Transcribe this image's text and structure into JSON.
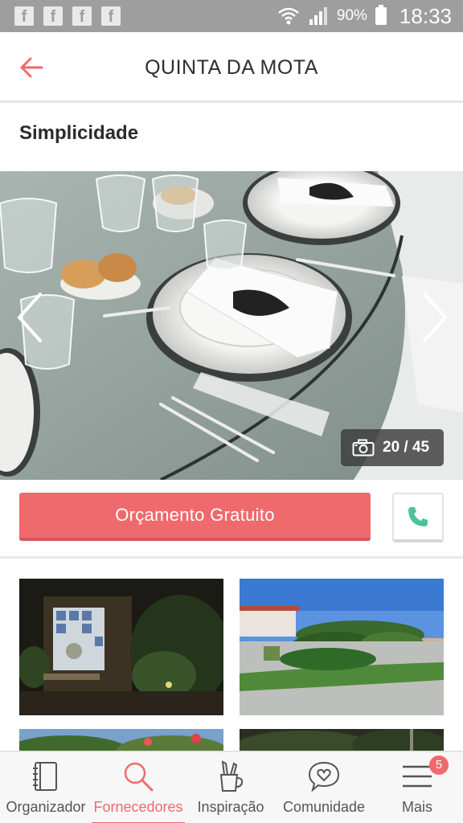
{
  "status_bar": {
    "notification_icons": [
      "facebook-icon",
      "facebook-icon",
      "facebook-icon",
      "facebook-icon"
    ],
    "battery_percent": "90%",
    "time": "18:33"
  },
  "header": {
    "title": "QUINTA DA MOTA",
    "back_icon": "arrow-left-icon"
  },
  "section": {
    "title": "Simplicidade"
  },
  "gallery": {
    "counter": "20 / 45",
    "prev_icon": "chevron-left-icon",
    "next_icon": "chevron-right-icon",
    "camera_icon": "camera-icon"
  },
  "actions": {
    "quote_label": "Orçamento Gratuito",
    "call_icon": "phone-icon"
  },
  "bottom_nav": {
    "items": [
      {
        "label": "Organizador",
        "icon": "notebook-icon",
        "active": false
      },
      {
        "label": "Fornecedores",
        "icon": "search-icon",
        "active": true
      },
      {
        "label": "Inspiração",
        "icon": "pencil-cup-icon",
        "active": false
      },
      {
        "label": "Comunidade",
        "icon": "chat-heart-icon",
        "active": false
      },
      {
        "label": "Mais",
        "icon": "menu-icon",
        "active": false,
        "badge": "5"
      }
    ]
  },
  "colors": {
    "accent": "#ef6a6d",
    "status_bar": "#9e9e9e",
    "phone_green": "#4cc39a"
  }
}
